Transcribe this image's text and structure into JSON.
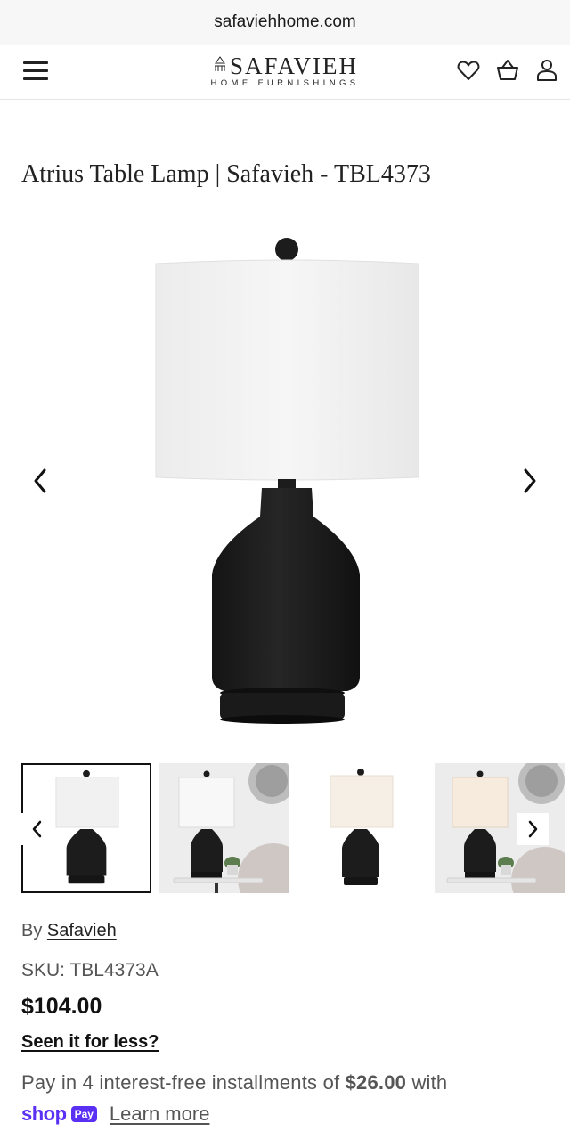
{
  "browser": {
    "url": "safaviehhome.com"
  },
  "header": {
    "logo_main": "SAFAVIEH",
    "logo_sub": "HOME FURNISHINGS",
    "icons": [
      "menu-icon",
      "heart-icon",
      "basket-icon",
      "user-icon"
    ]
  },
  "product": {
    "title": "Atrius Table Lamp | Safavieh - TBL4373",
    "by_prefix": "By",
    "brand": "Safavieh",
    "sku": "SKU: TBL4373A",
    "price": "$104.00",
    "seen_less": "Seen it for less?"
  },
  "payment": {
    "text_before": "Pay in 4 interest-free installments of",
    "installment": "$26.00",
    "text_after": "with",
    "shop_word": "shop",
    "pay_badge": "Pay",
    "learn_more": "Learn more"
  },
  "gallery": {
    "thumbnails": [
      {
        "name": "thumb-lamp-white-bg",
        "selected": true
      },
      {
        "name": "thumb-lamp-room-scene",
        "selected": false
      },
      {
        "name": "thumb-lamp-lit",
        "selected": false
      },
      {
        "name": "thumb-lamp-lit-room-scene",
        "selected": false
      }
    ]
  },
  "colors": {
    "shop_pay_purple": "#5a31f4",
    "lamp_black": "#1c1c1c",
    "shade_white": "#f3f3f3"
  }
}
